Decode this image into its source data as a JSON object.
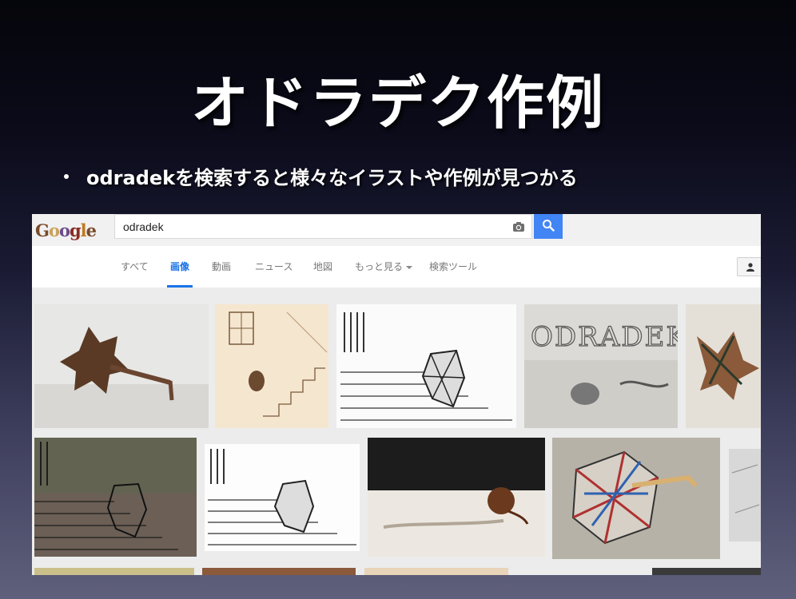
{
  "slide": {
    "title": "オドラデク作例",
    "bullet": "odradekを検索すると様々なイラストや作例が見つかる"
  },
  "google": {
    "logo_letters": [
      "G",
      "o",
      "o",
      "g",
      "l",
      "e"
    ],
    "search_value": "odradek",
    "tabs": [
      {
        "label": "すべて",
        "active": false
      },
      {
        "label": "画像",
        "active": true
      },
      {
        "label": "動画",
        "active": false
      },
      {
        "label": "ニュース",
        "active": false
      },
      {
        "label": "地図",
        "active": false
      },
      {
        "label": "もっと見る",
        "active": false
      },
      {
        "label": "検索ツール",
        "active": false
      }
    ],
    "accent_color": "#4285f4"
  },
  "thumbnails": {
    "odradek_sketch_text": "ODRADEK"
  }
}
